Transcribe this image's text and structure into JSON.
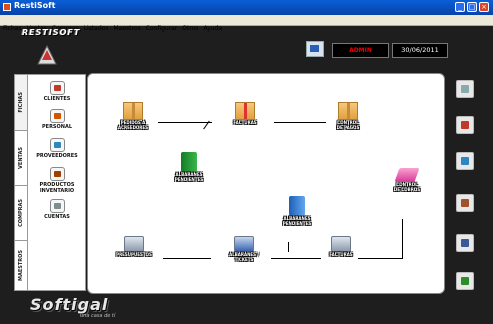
{
  "window": {
    "title": "RestiSoft"
  },
  "menu": [
    "Fichas",
    "Ventas",
    "Compras",
    "Listados",
    "Maestros",
    "Configurar",
    "Otros",
    "Ayuda"
  ],
  "brand": {
    "top_logo": "RESTISOFT",
    "footer_logo": "Softigal",
    "footer_sub": "una casa de tí"
  },
  "header": {
    "user": "ADMIN",
    "date": "30/06/2011"
  },
  "sidebar": {
    "tabs": [
      "FICHAS",
      "VENTAS",
      "COMPRAS",
      "MAESTROS"
    ],
    "items": [
      {
        "label": "CLIENTES",
        "icon": "clients-icon"
      },
      {
        "label": "PERSONAL",
        "icon": "staff-icon"
      },
      {
        "label": "PROVEEDORES",
        "icon": "suppliers-icon"
      },
      {
        "label": "PRODUCTOS\nINVENTARIO",
        "icon": "products-icon"
      },
      {
        "label": "CUENTAS",
        "icon": "accounts-icon"
      }
    ]
  },
  "workflow": {
    "pedidos": "PEDIDOS A\nACREEDORES",
    "facturas_compra": "FACTURAS",
    "control_pagos": "CONTROL\nDE PAGOS",
    "albaranes_pend_compra": "ALBARANES\nPENDIENTES",
    "albaranes_pend_venta": "ALBARANES\nPENDIENTES",
    "control_cobros": "CONTROL\nDE COBROS",
    "presupuestos": "PRESUPUESTOS",
    "albaranes_tickets": "ALBARANES /\nTICKETS",
    "facturas_venta": "FACTURAS"
  },
  "right_buttons": [
    "search-icon",
    "calendar-icon",
    "notepad-icon",
    "book-icon",
    "printer-icon",
    "exit-icon"
  ]
}
